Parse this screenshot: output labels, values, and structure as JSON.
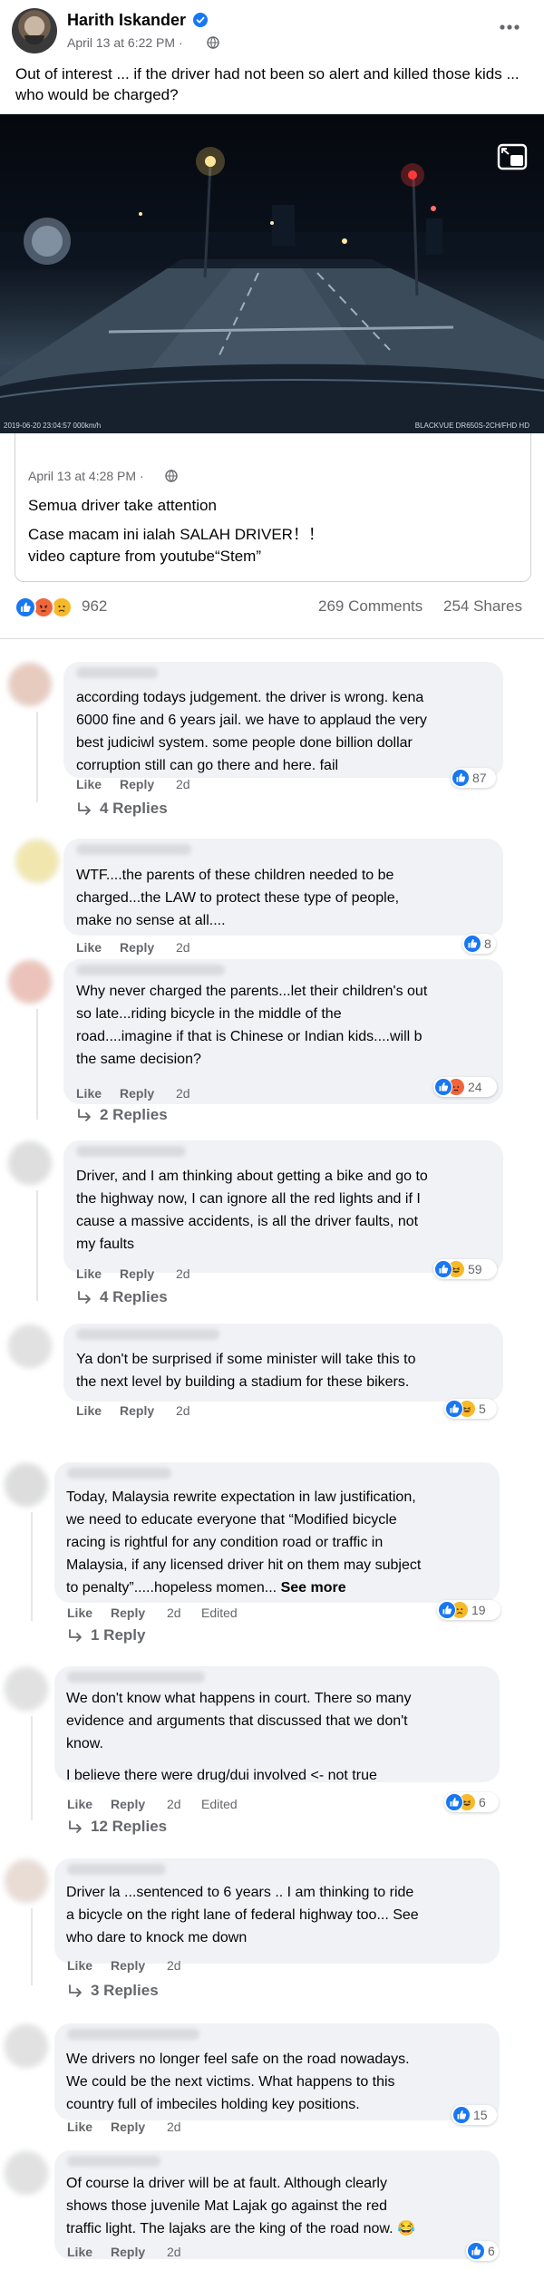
{
  "post": {
    "author": "Harith Iskander",
    "time": "April 13 at 6:22 PM ·",
    "text": "Out of interest ... if the driver had not been so alert and killed those kids ... who would be charged?"
  },
  "video": {
    "timestamp_text": "2019-06-20  23:04:57    000km/h",
    "brand_text": "BLACKVUE  DR650S-2CH/FHD HD"
  },
  "shared": {
    "time": "April 13 at 4:28 PM ·",
    "line1": "Semua driver take attention",
    "line2": "Case macam ini ialah SALAH DRIVER！！",
    "line3": "video capture from youtube“Stem”"
  },
  "stats": {
    "reactions": "962",
    "comments": "269 Comments",
    "shares": "254 Shares"
  },
  "labels": {
    "like": "Like",
    "reply": "Reply",
    "edited": "Edited",
    "see_more": "See more"
  },
  "comments": [
    {
      "lines": [
        "according todays judgement. the driver is wrong. kena",
        "6000 fine and 6 years jail. we have to applaud the very",
        "best judiciwl system. some people done billion dollar",
        "corruption still can go there and here. fail"
      ],
      "date": "2d",
      "reactions": "87",
      "replies": "4 Replies"
    },
    {
      "lines": [
        "WTF....the parents of these children needed to be",
        "charged...the LAW to protect these type of people,",
        "make no sense at all...."
      ],
      "date": "2d",
      "reactions": "8"
    },
    {
      "lines": [
        "Why never charged the parents...let their children's out",
        "so late...riding bicycle in the middle of the",
        "road....imagine if that is Chinese or Indian kids....will b",
        "the same decision?"
      ],
      "date": "2d",
      "reactions": "24",
      "replies": "2 Replies"
    },
    {
      "lines": [
        "Driver, and I am thinking about getting a bike and go to",
        "the highway now, I can ignore all the red lights and if I",
        "cause a massive accidents, is all the driver faults, not",
        "my faults"
      ],
      "date": "2d",
      "reactions": "59",
      "replies": "4 Replies"
    },
    {
      "lines": [
        "Ya don't be surprised if some minister will take this to",
        "the next level by building a stadium for these bikers."
      ],
      "date": "2d",
      "reactions": "5"
    },
    {
      "lines": [
        "Today, Malaysia rewrite expectation in law justification,",
        "we need to educate everyone that “Modified bicycle",
        "racing is rightful for any condition road or traffic in",
        "Malaysia, if any licensed driver hit on them may subject",
        "to penalty”.....hopeless momen... "
      ],
      "date": "2d",
      "reactions": "19",
      "replies": "1 Reply"
    },
    {
      "lines": [
        "We don't know what happens in court. There so many",
        "evidence and arguments that discussed that we don't",
        "know.",
        "I believe there were drug/dui involved <- not true"
      ],
      "date": "2d",
      "reactions": "6",
      "replies": "12 Replies"
    },
    {
      "lines": [
        "Driver la ...sentenced to 6 years .. I am thinking to ride",
        "a bicycle on the right lane of federal highway too... See",
        "who dare to knock me down"
      ],
      "date": "2d",
      "replies": "3 Replies"
    },
    {
      "lines": [
        "We drivers no longer feel safe on the road nowadays.",
        "We could be the next victims. What happens to this",
        "country full of imbeciles holding key positions."
      ],
      "date": "2d",
      "reactions": "15"
    },
    {
      "lines": [
        "Of course la driver will be at fault. Although clearly",
        "shows those juvenile Mat Lajak go against the red",
        "traffic light. The lajaks are the king of the road now. 😂"
      ],
      "date": "2d",
      "reactions": "6"
    }
  ],
  "colors": {
    "like_blue": "#1877f2",
    "bubble_bg": "#f0f2f5",
    "meta_gray": "#65676b"
  },
  "icons": [
    "verified-badge-icon",
    "globe-icon",
    "more-options-icon",
    "picture-in-picture-icon",
    "volume-icon",
    "like-reaction-icon",
    "angry-reaction-icon",
    "sad-reaction-icon",
    "haha-reaction-icon",
    "reply-arrow-icon"
  ]
}
